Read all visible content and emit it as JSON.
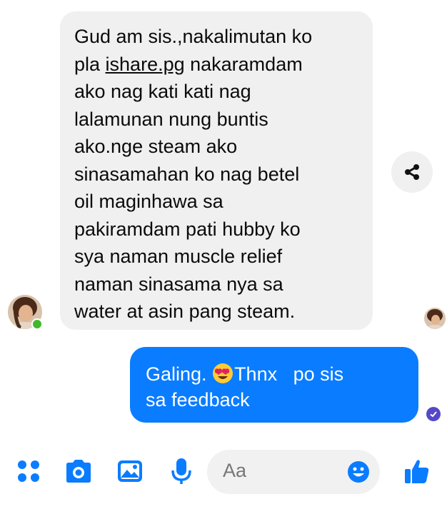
{
  "conversation": {
    "incoming_message": {
      "lines": [
        "Gud am sis.,nakalimutan ko",
        "pla ",
        "ishare.pg",
        " nakaramdam",
        "ako nag kati kati nag",
        "lalamunan nung buntis",
        "ako.nge steam ako",
        "sinasamahan ko nag betel",
        "oil maginhawa sa",
        "pakiramdam pati hubby ko",
        "sya naman muscle relief",
        "naman sinasama nya sa",
        "water at asin pang steam."
      ]
    },
    "outgoing_message": {
      "line1_a": "Galing. ",
      "line1_b": "Thnx   po sis",
      "line2": "sa feedback"
    }
  },
  "composer": {
    "placeholder": "Aa"
  },
  "colors": {
    "outgoing_bubble": "#0a7cff",
    "incoming_bubble": "#f0f0f0",
    "icon_blue": "#0a7cff",
    "online_green": "#42b72a",
    "seen_purple": "#5548c8"
  },
  "icons": [
    "share-icon",
    "menu-dots-icon",
    "camera-icon",
    "gallery-icon",
    "microphone-icon",
    "emoji-icon",
    "thumbs-up-icon",
    "heart-eyes-emoji",
    "seen-check-icon"
  ]
}
